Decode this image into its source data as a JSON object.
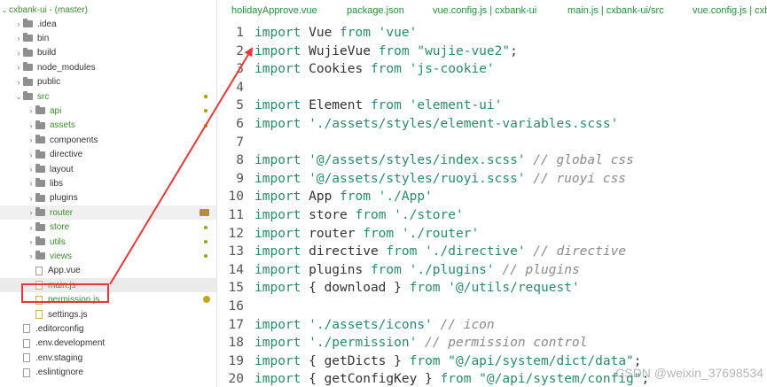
{
  "tree": {
    "root": "cxbank-ui - (master)",
    "items": [
      {
        "label": ".idea",
        "type": "folder",
        "arrow": "›"
      },
      {
        "label": "bin",
        "type": "folder",
        "arrow": "›"
      },
      {
        "label": "build",
        "type": "folder",
        "arrow": "›"
      },
      {
        "label": "node_modules",
        "type": "folder",
        "arrow": "›"
      },
      {
        "label": "public",
        "type": "folder",
        "arrow": "›"
      },
      {
        "label": "src",
        "type": "folder",
        "arrow": "⌄",
        "color": "green",
        "mark": "dot"
      },
      {
        "label": "api",
        "type": "folder",
        "arrow": "›",
        "color": "green",
        "mark": "dot"
      },
      {
        "label": "assets",
        "type": "folder",
        "arrow": "›",
        "color": "green",
        "mark": "dot"
      },
      {
        "label": "components",
        "type": "folder",
        "arrow": "›"
      },
      {
        "label": "directive",
        "type": "folder",
        "arrow": "›"
      },
      {
        "label": "layout",
        "type": "folder",
        "arrow": "›"
      },
      {
        "label": "libs",
        "type": "folder",
        "arrow": "›"
      },
      {
        "label": "plugins",
        "type": "folder",
        "arrow": "›"
      },
      {
        "label": "router",
        "type": "folder",
        "arrow": "›",
        "color": "green",
        "mark": "folder"
      },
      {
        "label": "store",
        "type": "folder",
        "arrow": "›",
        "color": "green",
        "mark": "dot"
      },
      {
        "label": "utils",
        "type": "folder",
        "arrow": "›",
        "color": "green",
        "mark": "dot"
      },
      {
        "label": "views",
        "type": "folder",
        "arrow": "›",
        "color": "green",
        "mark": "dot"
      },
      {
        "label": "App.vue",
        "type": "file"
      },
      {
        "label": "main.js",
        "type": "file",
        "color": "green"
      },
      {
        "label": "permission.js",
        "type": "file",
        "color": "green",
        "mark": "badge"
      },
      {
        "label": "settings.js",
        "type": "file"
      },
      {
        "label": ".editorconfig",
        "type": "file"
      },
      {
        "label": ".env.development",
        "type": "file"
      },
      {
        "label": ".env.staging",
        "type": "file"
      },
      {
        "label": ".eslintignore",
        "type": "file"
      }
    ]
  },
  "tabs": [
    "holidayApprove.vue",
    "package.json",
    "vue.config.js | cxbank-ui",
    "main.js | cxbank-ui/src",
    "vue.config.js | cxbank-ui"
  ],
  "code": [
    {
      "n": "1",
      "t": [
        [
          "kw",
          "import"
        ],
        [
          "",
          "Vue "
        ],
        [
          "kw",
          "from"
        ],
        [
          "str",
          " 'vue'"
        ]
      ]
    },
    {
      "n": "2",
      "t": [
        [
          "kw",
          "import"
        ],
        [
          "",
          "WujieVue "
        ],
        [
          "kw",
          "from"
        ],
        [
          "str",
          " \"wujie-vue2\""
        ],
        [
          "",
          ";"
        ]
      ]
    },
    {
      "n": "3",
      "t": [
        [
          "kw",
          "import"
        ],
        [
          "",
          "Cookies "
        ],
        [
          "kw",
          "from"
        ],
        [
          "str",
          " 'js-cookie'"
        ]
      ]
    },
    {
      "n": "4",
      "t": []
    },
    {
      "n": "5",
      "t": [
        [
          "kw",
          "import"
        ],
        [
          "",
          "Element "
        ],
        [
          "kw",
          "from"
        ],
        [
          "str",
          " 'element-ui'"
        ]
      ]
    },
    {
      "n": "6",
      "t": [
        [
          "kw",
          "import"
        ],
        [
          "str",
          "'./assets/styles/element-variables.scss'"
        ]
      ]
    },
    {
      "n": "7",
      "t": []
    },
    {
      "n": "8",
      "t": [
        [
          "kw",
          "import"
        ],
        [
          "str",
          "'@/assets/styles/index.scss'"
        ],
        [
          "cm",
          " // global css"
        ]
      ]
    },
    {
      "n": "9",
      "t": [
        [
          "kw",
          "import"
        ],
        [
          "str",
          "'@/assets/styles/ruoyi.scss'"
        ],
        [
          "cm",
          " // ruoyi css"
        ]
      ]
    },
    {
      "n": "10",
      "t": [
        [
          "kw",
          "import"
        ],
        [
          "",
          "App "
        ],
        [
          "kw",
          "from"
        ],
        [
          "str",
          " './App'"
        ]
      ]
    },
    {
      "n": "11",
      "t": [
        [
          "kw",
          "import"
        ],
        [
          "",
          "store "
        ],
        [
          "kw",
          "from"
        ],
        [
          "str",
          " './store'"
        ]
      ]
    },
    {
      "n": "12",
      "t": [
        [
          "kw",
          "import"
        ],
        [
          "",
          "router "
        ],
        [
          "kw",
          "from"
        ],
        [
          "str",
          " './router'"
        ]
      ]
    },
    {
      "n": "13",
      "t": [
        [
          "kw",
          "import"
        ],
        [
          "",
          "directive "
        ],
        [
          "kw",
          "from"
        ],
        [
          "str",
          " './directive'"
        ],
        [
          "cm",
          " // directive"
        ]
      ]
    },
    {
      "n": "14",
      "t": [
        [
          "kw",
          "import"
        ],
        [
          "",
          "plugins "
        ],
        [
          "kw",
          "from"
        ],
        [
          "str",
          " './plugins'"
        ],
        [
          "cm",
          " // plugins"
        ]
      ]
    },
    {
      "n": "15",
      "t": [
        [
          "kw",
          "import"
        ],
        [
          "",
          "{ download } "
        ],
        [
          "kw",
          "from"
        ],
        [
          "str",
          " '@/utils/request'"
        ]
      ]
    },
    {
      "n": "16",
      "t": []
    },
    {
      "n": "17",
      "t": [
        [
          "kw",
          "import"
        ],
        [
          "str",
          "'./assets/icons'"
        ],
        [
          "cm",
          " // icon"
        ]
      ]
    },
    {
      "n": "18",
      "t": [
        [
          "kw",
          "import"
        ],
        [
          "str",
          "'./permission'"
        ],
        [
          "cm",
          " // permission control"
        ]
      ]
    },
    {
      "n": "19",
      "t": [
        [
          "kw",
          "import"
        ],
        [
          "",
          "{ getDicts } "
        ],
        [
          "kw",
          "from"
        ],
        [
          "str",
          " \"@/api/system/dict/data\""
        ],
        [
          "",
          ";"
        ]
      ]
    },
    {
      "n": "20",
      "t": [
        [
          "kw",
          "import"
        ],
        [
          "",
          "{ getConfigKey } "
        ],
        [
          "kw",
          "from"
        ],
        [
          "str",
          " \"@/api/system/config\""
        ],
        [
          "",
          ";"
        ]
      ]
    }
  ],
  "watermark": "CSDN @weixin_37698534",
  "colors": {
    "highlight": "#e53935",
    "string": "#2b8a6a",
    "comment": "#8a8a8a"
  }
}
